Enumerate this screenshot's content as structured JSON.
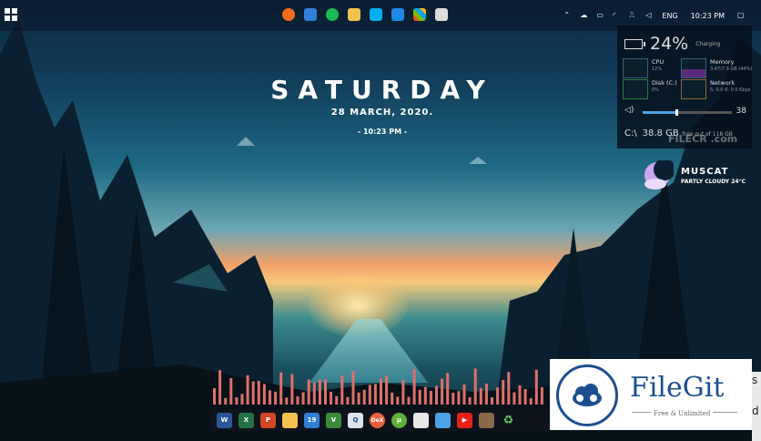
{
  "topbar": {
    "tray": {
      "language": "ENG",
      "clock": "10:23 PM"
    }
  },
  "widget": {
    "day": "SATURDAY",
    "date": "28 MARCH, 2020.",
    "time": "- 10:23 PM -"
  },
  "system_panel": {
    "battery": {
      "percent": "24%",
      "status": "Charging"
    },
    "cpu": {
      "label": "CPU",
      "value": "12%"
    },
    "memory": {
      "label": "Memory",
      "value": "3.47/7.9 GB (44%)"
    },
    "disk": {
      "label": "Disk (C:)",
      "value": "0%"
    },
    "network": {
      "label": "Network",
      "value": "S: 0.0 R: 0.0 Kbps"
    },
    "volume": {
      "value": "38",
      "level": 0.38
    },
    "drive": {
      "label": "C:\\",
      "free": "38.8 GB",
      "detail": "free out of 118 GB"
    }
  },
  "watermark": "FILECR .com",
  "weather": {
    "city": "MUSCAT",
    "condition": "PARTLY CLOUDY 24°C"
  },
  "dock": {
    "icons": [
      "word-icon",
      "excel-icon",
      "powerpoint-icon",
      "explorer-icon",
      "calendar-icon",
      "vim-icon",
      "search-icon",
      "dex-icon",
      "torrent-icon",
      "notepad-icon",
      "shortcut-icon",
      "youtube-icon",
      "game-icon",
      "recycle-icon"
    ],
    "labels": {
      "calendar": "19",
      "dex": "DeX"
    }
  },
  "logo": {
    "name": "FileGit",
    "tagline": "Free & Unlimited"
  },
  "edge_text": [
    "s",
    "d"
  ],
  "colors": {
    "accent": "#4aa3e8",
    "visualizer": "#e0706a",
    "logo": "#1c4f8f"
  }
}
